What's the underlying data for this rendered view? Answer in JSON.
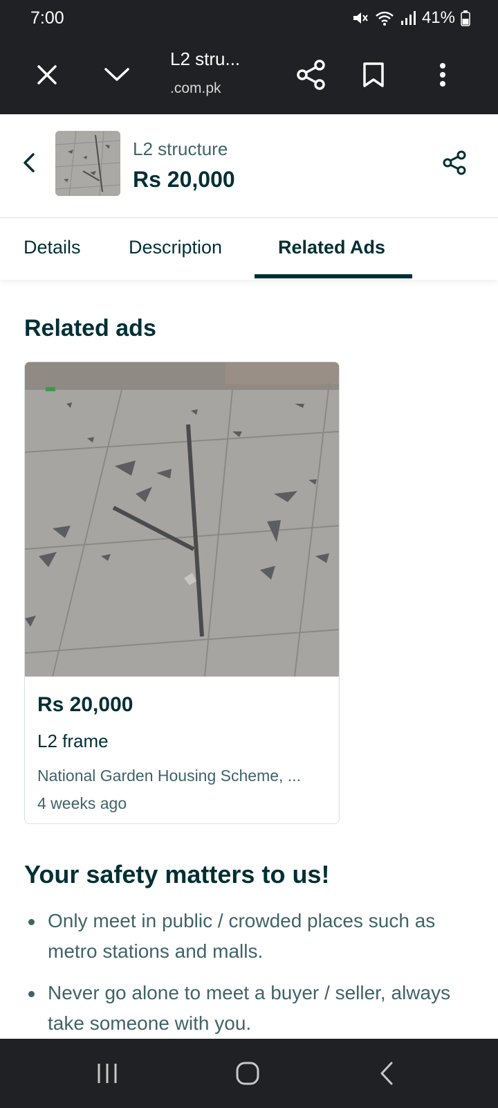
{
  "status_bar": {
    "time": "7:00",
    "battery": "41%",
    "icons": [
      "mute-icon",
      "wifi-icon",
      "signal-icon",
      "battery-icon"
    ]
  },
  "toolbar": {
    "title": "L2 stru...",
    "url": ".com.pk",
    "icons": [
      "close-icon",
      "chevron-down-icon",
      "share-icon",
      "bookmark-icon",
      "more-vert-icon"
    ]
  },
  "ad_header": {
    "title": "L2 structure",
    "price": "Rs 20,000"
  },
  "tabs": [
    {
      "label": "Details",
      "active": false
    },
    {
      "label": "Description",
      "active": false
    },
    {
      "label": "Related Ads",
      "active": true
    }
  ],
  "related": {
    "heading": "Related ads",
    "cards": [
      {
        "price": "Rs 20,000",
        "title": "L2 frame",
        "location": "National Garden Housing Scheme, ...",
        "posted": "4 weeks ago"
      }
    ]
  },
  "safety": {
    "heading": "Your safety matters to us!",
    "tips": [
      "Only meet in public / crowded places such as metro stations and malls.",
      "Never go alone to meet a buyer / seller, always take someone with you."
    ]
  },
  "nav_bar": {
    "icons": [
      "recents-icon",
      "home-icon",
      "back-icon"
    ]
  },
  "colors": {
    "primary": "#002f34",
    "secondary_text": "#406367",
    "chrome": "#202124"
  }
}
